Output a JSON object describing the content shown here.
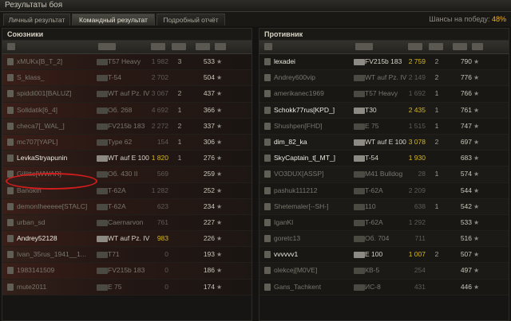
{
  "window": {
    "title": "Результаты боя"
  },
  "tabs": [
    {
      "label": "Личный результат",
      "active": false
    },
    {
      "label": "Командный результат",
      "active": true
    },
    {
      "label": "Подробный отчёт",
      "active": false
    }
  ],
  "win_chance": {
    "label": "Шансы на победу:",
    "value": "48%"
  },
  "colors": {
    "accent": "#f2b021",
    "highlight_oval": "#d21d1d"
  },
  "allies": {
    "title": "Союзники",
    "rows": [
      {
        "name": "xMUKx[B_T_2]",
        "vehicle": "T57 Heavy",
        "damage": "1 982",
        "kills": "3",
        "xp": "533",
        "alive": false,
        "highlight": false
      },
      {
        "name": "S_klass_",
        "vehicle": "T-54",
        "damage": "2 702",
        "kills": "",
        "xp": "504",
        "alive": false,
        "highlight": false
      },
      {
        "name": "spiddi001[BALUZ]",
        "vehicle": "WT auf Pz. IV",
        "damage": "3 067",
        "kills": "2",
        "xp": "437",
        "alive": false,
        "highlight": false
      },
      {
        "name": "Solldatik[6_4]",
        "vehicle": "Об. 268",
        "damage": "4 692",
        "kills": "1",
        "xp": "366",
        "alive": false,
        "highlight": false
      },
      {
        "name": "checa7[_WAL_]",
        "vehicle": "FV215b 183",
        "damage": "2 272",
        "kills": "2",
        "xp": "337",
        "alive": false,
        "highlight": false
      },
      {
        "name": "mc707[YAPL]",
        "vehicle": "Type 62",
        "damage": "154",
        "kills": "1",
        "xp": "306",
        "alive": false,
        "highlight": false
      },
      {
        "name": "LevkaStryapunin",
        "vehicle": "WT auf E 100",
        "damage": "1 820",
        "kills": "1",
        "xp": "276",
        "alive": true,
        "highlight": true
      },
      {
        "name": "Gillitte[WWAR]",
        "vehicle": "Об. 430 II",
        "damage": "569",
        "kills": "",
        "xp": "259",
        "alive": false,
        "highlight": false
      },
      {
        "name": "Banokin",
        "vehicle": "T-62A",
        "damage": "1 282",
        "kills": "",
        "xp": "252",
        "alive": false,
        "highlight": false
      },
      {
        "name": "demonIheeeee[STALC]",
        "vehicle": "T-62A",
        "damage": "623",
        "kills": "",
        "xp": "234",
        "alive": false,
        "highlight": false
      },
      {
        "name": "urban_sd",
        "vehicle": "Caernarvon",
        "damage": "761",
        "kills": "",
        "xp": "227",
        "alive": false,
        "highlight": false
      },
      {
        "name": "Andrey52128",
        "vehicle": "WT auf Pz. IV",
        "damage": "983",
        "kills": "",
        "xp": "226",
        "alive": true,
        "highlight": true
      },
      {
        "name": "Ivan_35rus_1941__1...",
        "vehicle": "T71",
        "damage": "0",
        "kills": "",
        "xp": "193",
        "alive": false,
        "highlight": false
      },
      {
        "name": "1983141509",
        "vehicle": "FV215b 183",
        "damage": "0",
        "kills": "",
        "xp": "186",
        "alive": false,
        "highlight": false
      },
      {
        "name": "mute2011",
        "vehicle": "E 75",
        "damage": "0",
        "kills": "",
        "xp": "174",
        "alive": false,
        "highlight": false
      }
    ]
  },
  "enemies": {
    "title": "Противник",
    "rows": [
      {
        "name": "lexadei",
        "vehicle": "FV215b 183",
        "damage": "2 759",
        "kills": "2",
        "xp": "790",
        "alive": true,
        "highlight": true
      },
      {
        "name": "Andrey600vip",
        "vehicle": "WT auf Pz. IV",
        "damage": "2 149",
        "kills": "2",
        "xp": "776",
        "alive": false,
        "highlight": false
      },
      {
        "name": "amerikanec1969",
        "vehicle": "T57 Heavy",
        "damage": "1 692",
        "kills": "1",
        "xp": "766",
        "alive": false,
        "highlight": false
      },
      {
        "name": "Schokk77rus[KPD_]",
        "vehicle": "T30",
        "damage": "2 435",
        "kills": "1",
        "xp": "761",
        "alive": true,
        "highlight": true
      },
      {
        "name": "Shushpen[FHD]",
        "vehicle": "E 75",
        "damage": "1 515",
        "kills": "1",
        "xp": "747",
        "alive": false,
        "highlight": false
      },
      {
        "name": "dim_82_ka",
        "vehicle": "WT auf E 100",
        "damage": "3 078",
        "kills": "2",
        "xp": "697",
        "alive": true,
        "highlight": true
      },
      {
        "name": "SkyCaptain_t[_MT_]",
        "vehicle": "T-54",
        "damage": "1 930",
        "kills": "",
        "xp": "683",
        "alive": true,
        "highlight": true
      },
      {
        "name": "VO3DUX[ASSP]",
        "vehicle": "M41 Bulldog",
        "damage": "28",
        "kills": "1",
        "xp": "574",
        "alive": false,
        "highlight": false
      },
      {
        "name": "pashuk111212",
        "vehicle": "T-62A",
        "damage": "2 209",
        "kills": "",
        "xp": "544",
        "alive": false,
        "highlight": false
      },
      {
        "name": "Shetemaler[--SH-]",
        "vehicle": "110",
        "damage": "638",
        "kills": "1",
        "xp": "542",
        "alive": false,
        "highlight": false
      },
      {
        "name": "IganKl",
        "vehicle": "T-62A",
        "damage": "1 292",
        "kills": "",
        "xp": "533",
        "alive": false,
        "highlight": false
      },
      {
        "name": "goretc13",
        "vehicle": "Об. 704",
        "damage": "711",
        "kills": "",
        "xp": "516",
        "alive": false,
        "highlight": false
      },
      {
        "name": "vvvvvv1",
        "vehicle": "E 100",
        "damage": "1 007",
        "kills": "2",
        "xp": "507",
        "alive": true,
        "highlight": true
      },
      {
        "name": "olekcej[M0VE]",
        "vehicle": "КВ-5",
        "damage": "254",
        "kills": "",
        "xp": "497",
        "alive": false,
        "highlight": false
      },
      {
        "name": "Gans_Tachkent",
        "vehicle": "ИС-8",
        "damage": "431",
        "kills": "",
        "xp": "446",
        "alive": false,
        "highlight": false
      }
    ]
  }
}
